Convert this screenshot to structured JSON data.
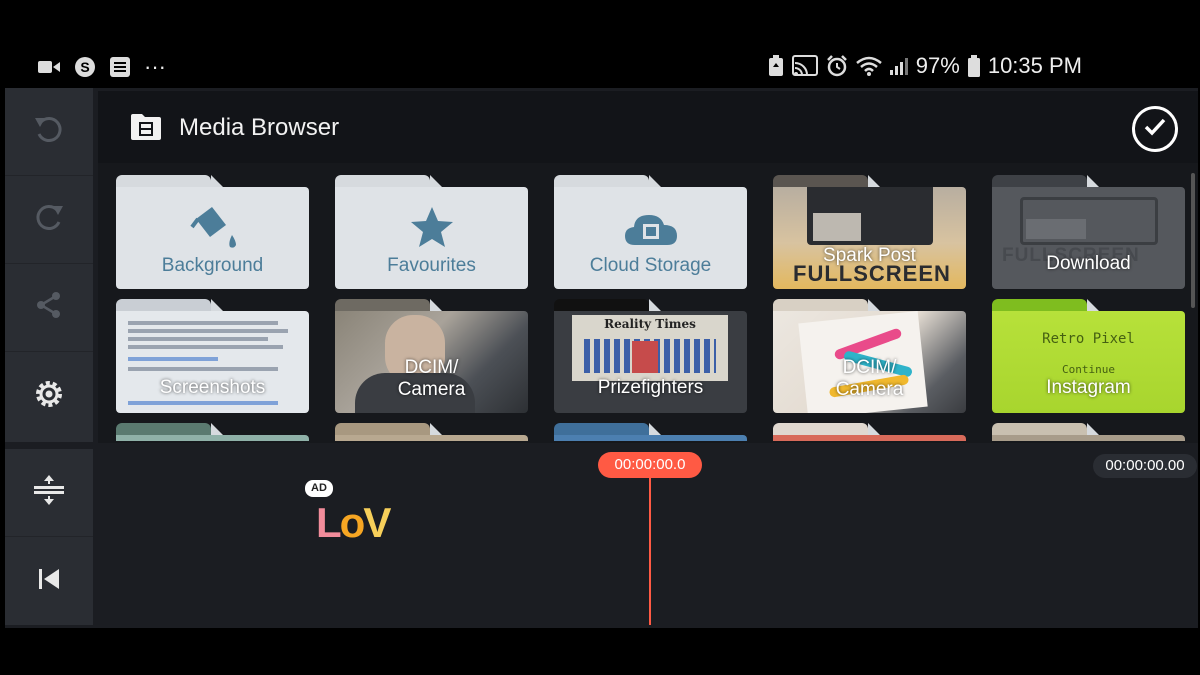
{
  "status_bar": {
    "left_icons": [
      "video-icon",
      "s-app-icon",
      "notes-icon",
      "more-dots-icon"
    ],
    "more_dots": "···",
    "right_icons": [
      "battery-saver-icon",
      "cast-icon",
      "alarm-icon",
      "wifi-icon",
      "signal-icon"
    ],
    "battery": "97%",
    "time": "10:35 PM"
  },
  "toolbar": {
    "items": [
      "undo-icon",
      "redo-icon",
      "share-icon",
      "settings-icon"
    ],
    "bottom_items": [
      "track-height-icon",
      "skip-to-start-icon"
    ]
  },
  "browser": {
    "title": "Media Browser",
    "confirm_icon": "checkmark-icon",
    "folders": [
      {
        "label": "Background"
      },
      {
        "label": "Favourites"
      },
      {
        "label": "Cloud Storage"
      },
      {
        "label": "Spark Post",
        "thumb_text": "FULLSCREEN"
      },
      {
        "label": "Download",
        "thumb_text": "FULLSCREEN"
      },
      {
        "label": "Screenshots"
      },
      {
        "label": "DCIM/\nCamera"
      },
      {
        "label": "Prizefighters",
        "thumb_text": "Reality Times"
      },
      {
        "label": "DCIM/\nCamera"
      },
      {
        "label": "Instagram",
        "thumb_text": "Retro Pixel",
        "thumb_sub": "Continue"
      }
    ]
  },
  "timeline": {
    "playhead_time": "00:00:00.0",
    "total_time": "00:00:00.00",
    "ad_badge": "AD",
    "ad_logo": {
      "l": "L",
      "o": "o",
      "v": "V"
    }
  },
  "colors": {
    "accent": "#ff5a44",
    "folder_light": "#dfe3e7",
    "folder_label": "#4c7d99",
    "toolbar_bg": "#2a2d33"
  }
}
